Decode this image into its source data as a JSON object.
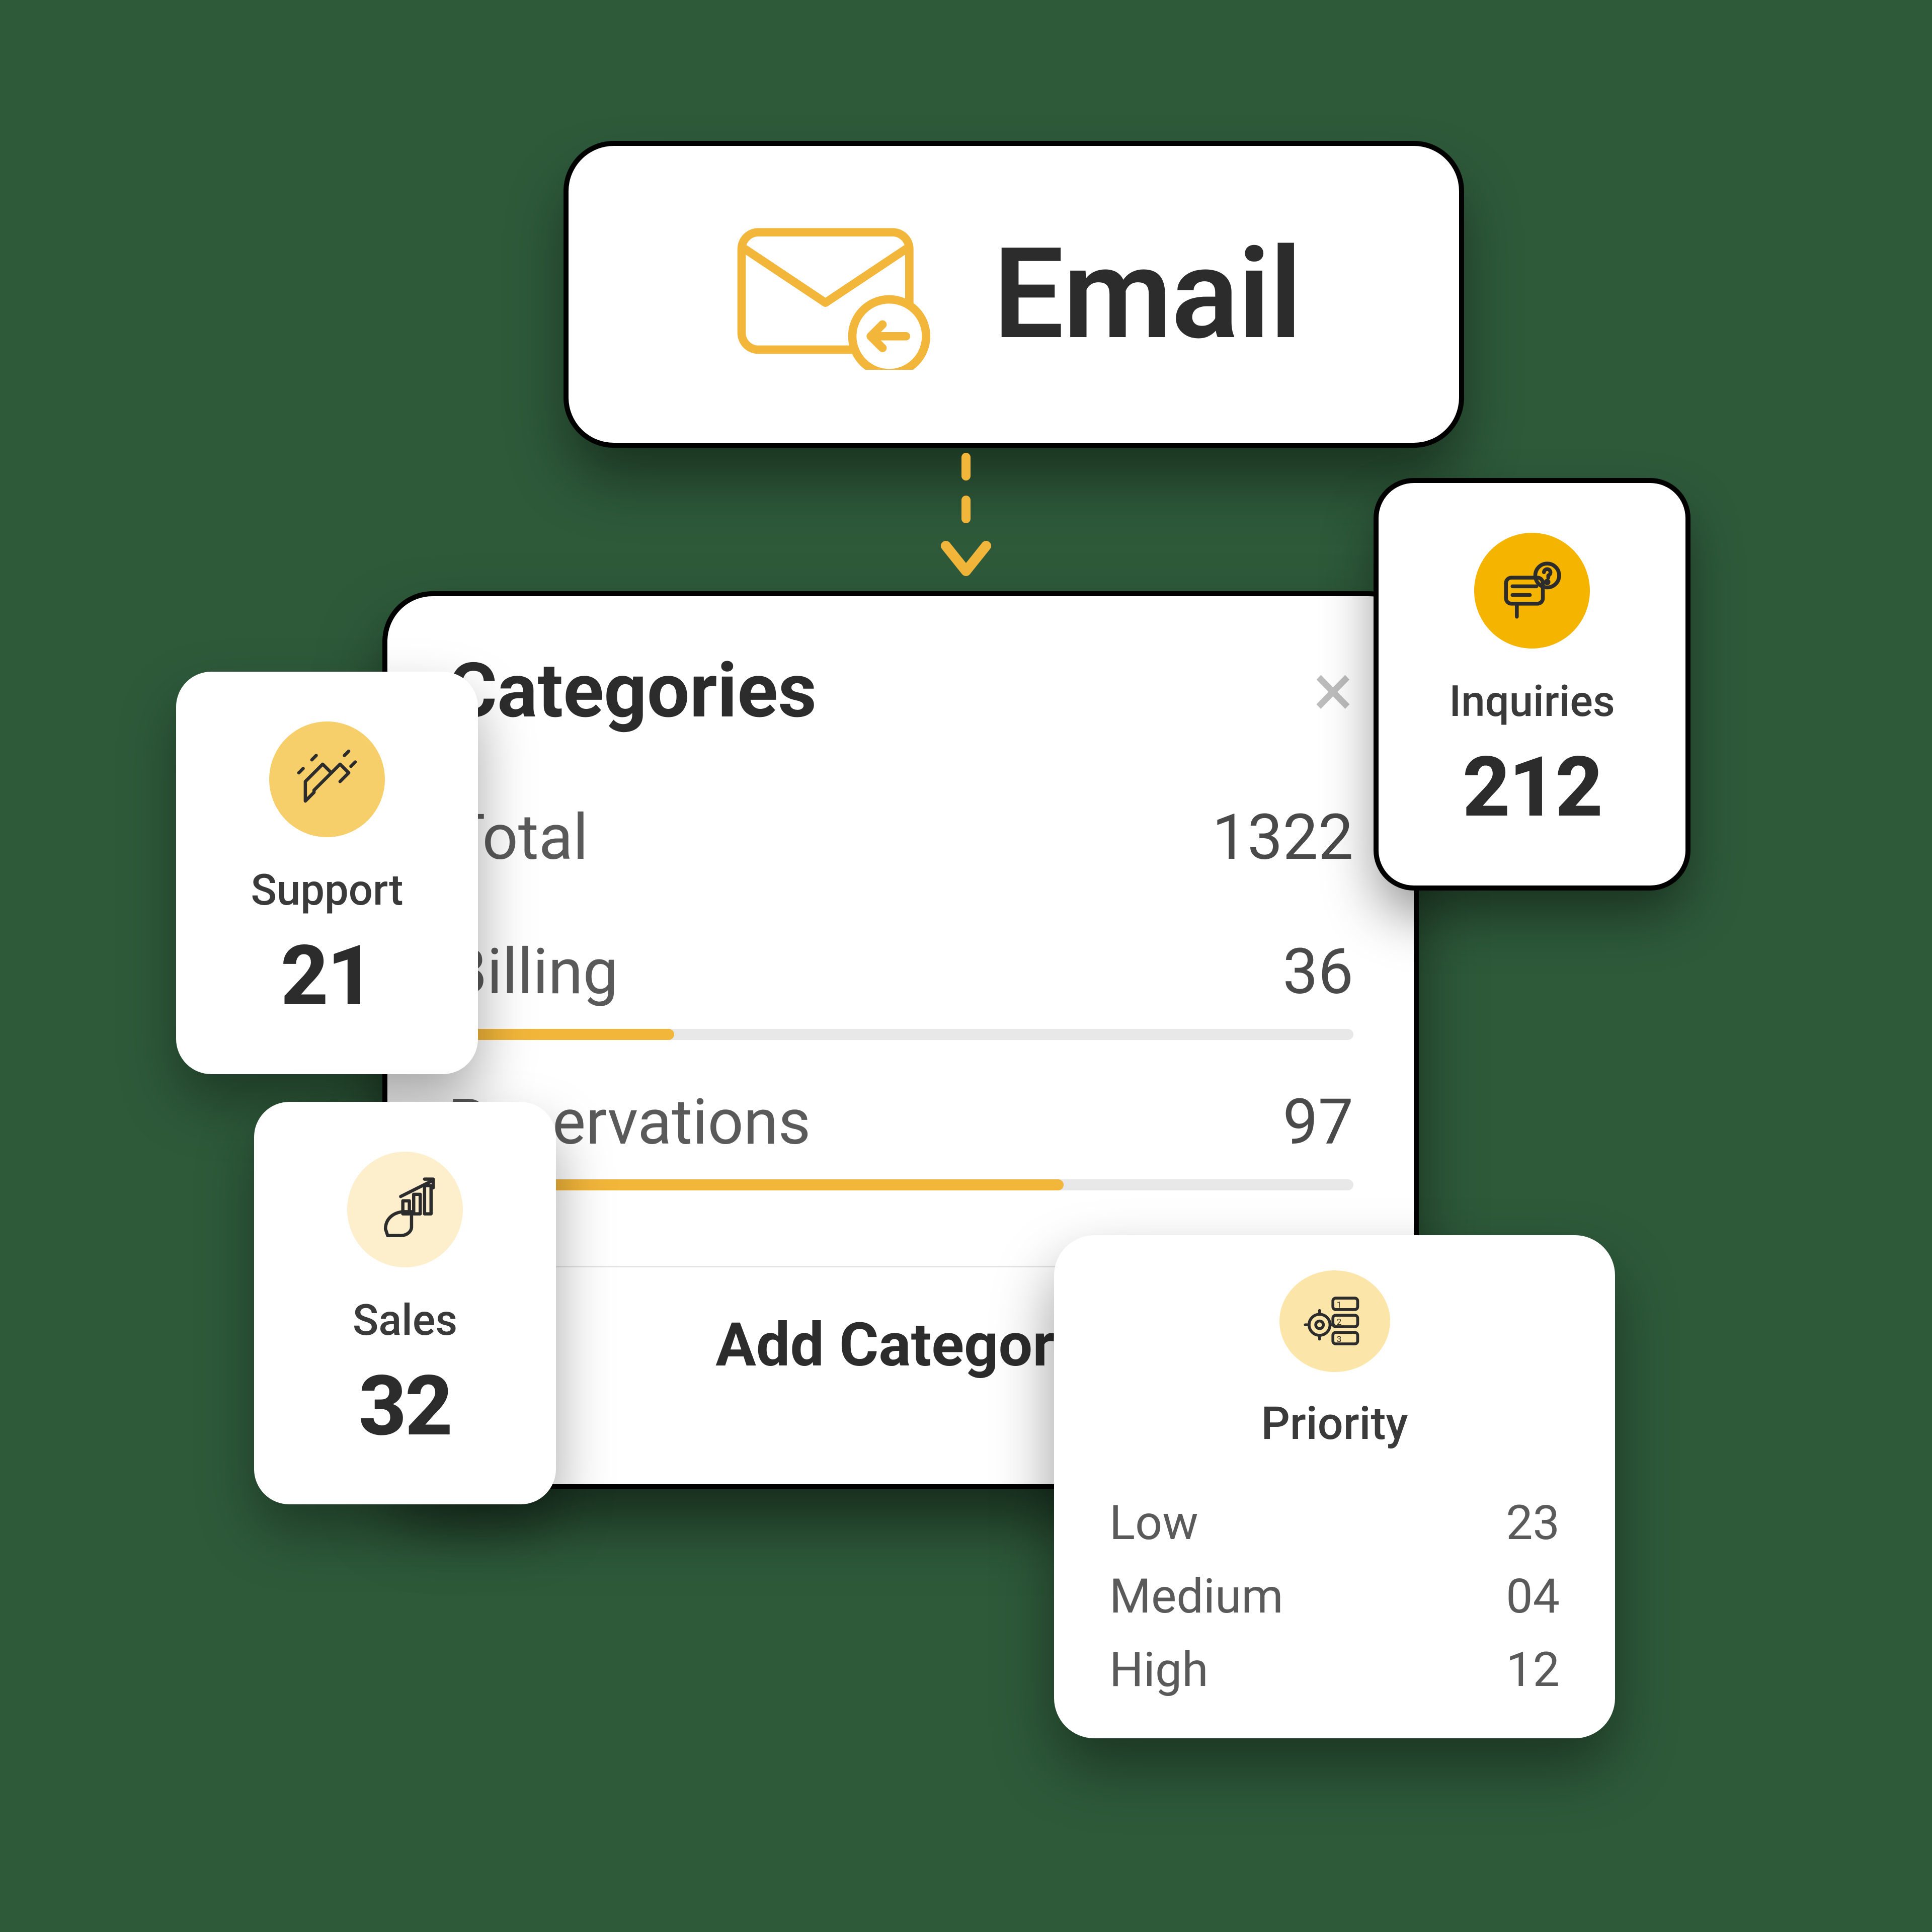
{
  "email": {
    "label": "Email"
  },
  "panel": {
    "title": "Categories",
    "total_label": "Total",
    "total_value": "1322",
    "categories": [
      {
        "name": "Billing",
        "value": "36",
        "percent": 25
      },
      {
        "name": "Reservations",
        "value": "97",
        "percent": 68
      }
    ],
    "add_label": "Add Category"
  },
  "cards": {
    "support": {
      "label": "Support",
      "value": "21"
    },
    "sales": {
      "label": "Sales",
      "value": "32"
    },
    "inquiries": {
      "label": "Inquiries",
      "value": "212"
    }
  },
  "priority": {
    "title": "Priority",
    "rows": [
      {
        "label": "Low",
        "value": "23"
      },
      {
        "label": "Medium",
        "value": "04"
      },
      {
        "label": "High",
        "value": "12"
      }
    ]
  }
}
